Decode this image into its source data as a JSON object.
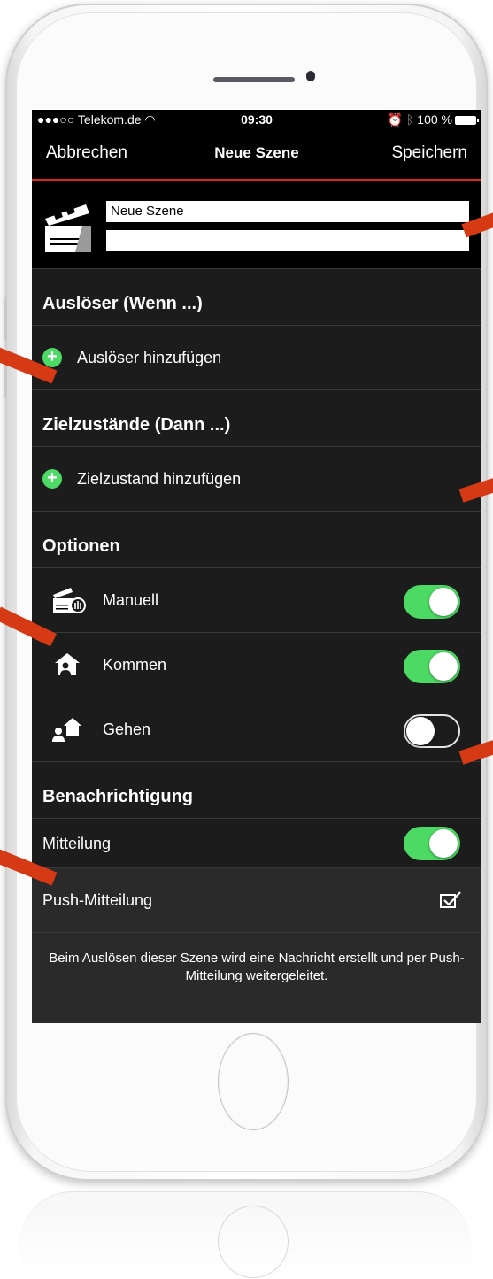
{
  "status_bar": {
    "carrier": "●●●○○ Telekom.de",
    "time": "09:30",
    "battery": "100 %"
  },
  "navbar": {
    "cancel": "Abbrechen",
    "title": "Neue Szene",
    "save": "Speichern"
  },
  "scene": {
    "name_value": "Neue Szene",
    "description_value": ""
  },
  "triggers": {
    "header": "Auslöser (Wenn ...)",
    "add_label": "Auslöser hinzufügen"
  },
  "targets": {
    "header": "Zielzustände (Dann ...)",
    "add_label": "Zielzustand hinzufügen"
  },
  "options": {
    "header": "Optionen",
    "items": [
      {
        "label": "Manuell",
        "icon": "clapper-hand-icon",
        "enabled": true
      },
      {
        "label": "Kommen",
        "icon": "person-home-icon",
        "enabled": true
      },
      {
        "label": "Gehen",
        "icon": "person-leave-icon",
        "enabled": false
      }
    ]
  },
  "notification": {
    "header": "Benachrichtigung",
    "message_label": "Mitteilung",
    "message_enabled": true,
    "push_label": "Push-Mitteilung",
    "push_checked": true,
    "description": "Beim Auslösen dieser Szene wird eine Nachricht erstellt und per Push-Mitteilung weitergeleitet."
  },
  "colors": {
    "accent": "#e0231b",
    "toggle_on": "#4cd964",
    "callout": "#d63a15"
  }
}
